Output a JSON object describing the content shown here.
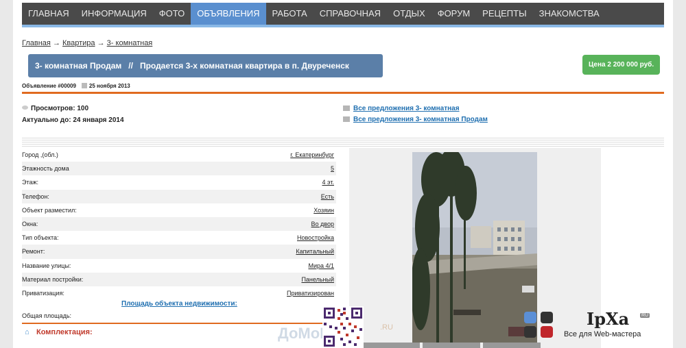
{
  "nav": [
    {
      "label": "ГЛАВНАЯ",
      "active": false
    },
    {
      "label": "ИНФОРМАЦИЯ",
      "active": false
    },
    {
      "label": "ФОТО",
      "active": false
    },
    {
      "label": "ОБЪЯВЛЕНИЯ",
      "active": true
    },
    {
      "label": "РАБОТА",
      "active": false
    },
    {
      "label": "СПРАВОЧНАЯ",
      "active": false
    },
    {
      "label": "ОТДЫХ",
      "active": false
    },
    {
      "label": "ФОРУМ",
      "active": false
    },
    {
      "label": "РЕЦЕПТЫ",
      "active": false
    },
    {
      "label": "ЗНАКОМСТВА",
      "active": false
    }
  ],
  "breadcrumb": {
    "home": "Главная",
    "section": "Квартира",
    "current": "3- комнатная",
    "sep": "→"
  },
  "listing": {
    "category": "3- комнатная Продам",
    "sep": "//",
    "title": "Продается 3-х комнатная квартира в п. Двуреченск",
    "price": "Цена 2 200 000 руб.",
    "number": "Объявление #00009",
    "date": "25 ноября 2013",
    "views": "Просмотров: 100",
    "actual": "Актуально до: 24 января 2014",
    "offers": [
      "Все предложения 3- комнатная",
      "Все предложения 3- комнатная Продам"
    ]
  },
  "params": [
    {
      "label": "Город ,(обл.)",
      "value": "г. Екатеринбург"
    },
    {
      "label": "Этажность дома",
      "value": "5"
    },
    {
      "label": "Этаж:",
      "value": "4 эт."
    },
    {
      "label": "Телефон:",
      "value": "Есть"
    },
    {
      "label": "Объект разместил:",
      "value": "Хозяин"
    },
    {
      "label": "Окна:",
      "value": "Во двор"
    },
    {
      "label": "Тип объекта:",
      "value": "Новостройка"
    },
    {
      "label": "Ремонт:",
      "value": "Капитальный"
    },
    {
      "label": "Название улицы:",
      "value": "Мира 4/1"
    },
    {
      "label": "Материал постройки:",
      "value": "Панельный"
    },
    {
      "label": "Приватизация:",
      "value": "Приватизирован"
    }
  ],
  "area": {
    "link": "Площадь объекта недвижимости:",
    "total": "Общая площадь:"
  },
  "kompl": {
    "title": "Комплектация:",
    "icon": "home-icon"
  },
  "watermark": {
    "site": "ДоМоПор",
    "ru": ".RU",
    "logo": "IpXa",
    "logo_ru": "RU",
    "logo_sub": "Все для Web-мастера"
  },
  "colors": {
    "nav_bg": "#4a4a4a",
    "nav_active": "#5a8fcf",
    "title_bg": "#5b7fa8",
    "price_bg": "#58b35a",
    "accent": "#e06a1f",
    "link": "#1f6fb0"
  }
}
